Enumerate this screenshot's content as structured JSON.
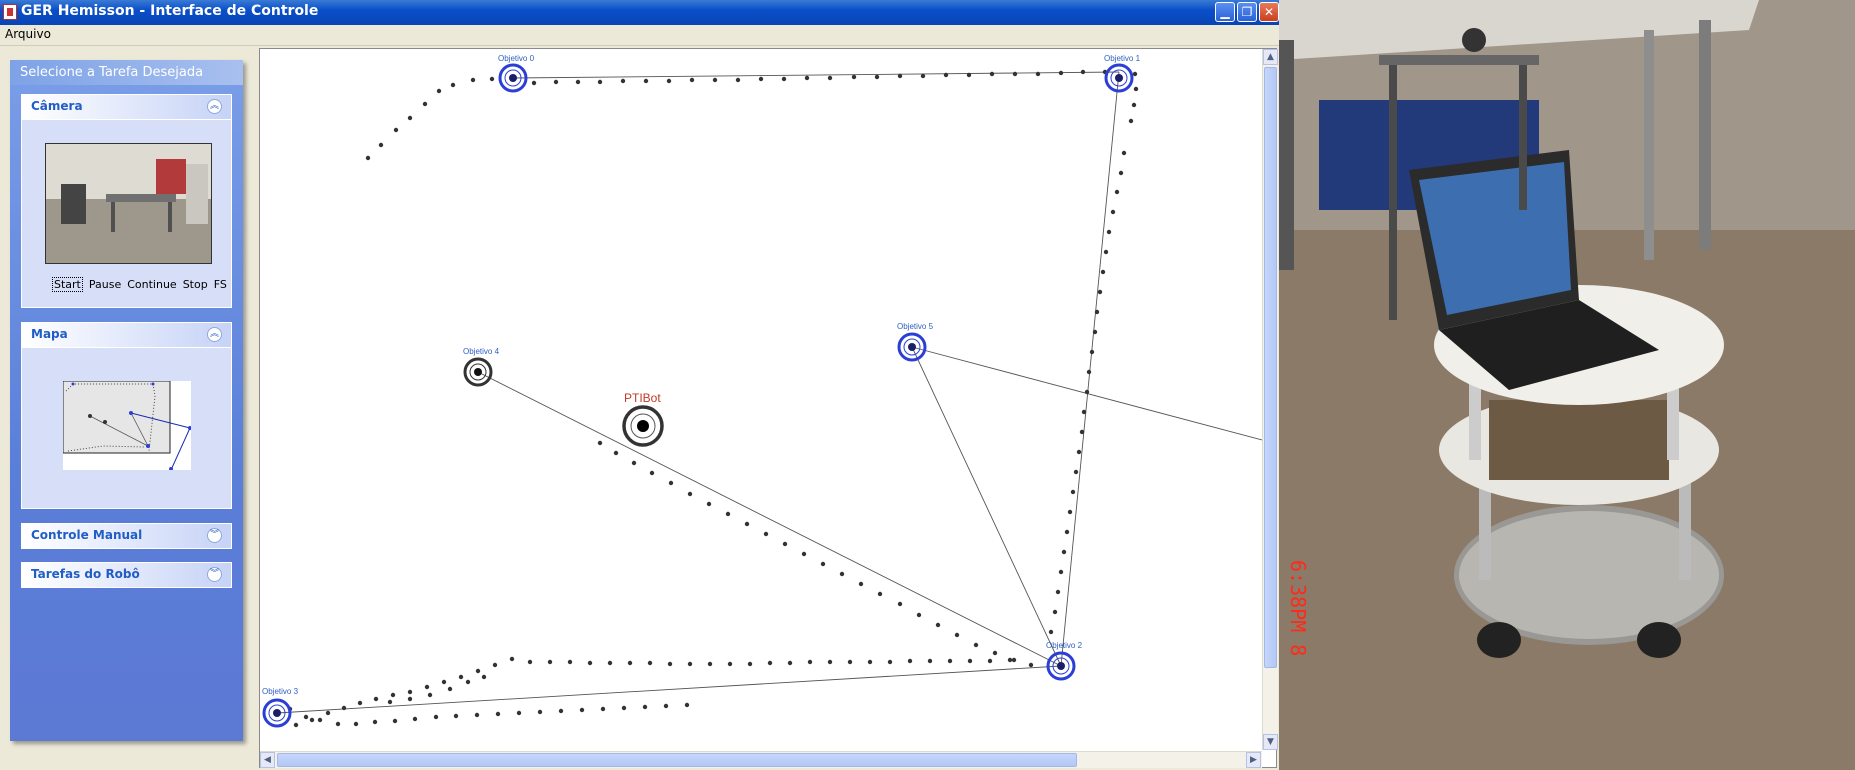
{
  "window": {
    "title": "GER Hemisson - Interface de Controle",
    "controls": {
      "minimize": "minimize-icon",
      "restore": "restore-icon",
      "close": "close-icon"
    }
  },
  "menubar": {
    "items": [
      "Arquivo"
    ]
  },
  "panel": {
    "header": "Selecione a Tarefa Desejada",
    "sections": {
      "camera": {
        "title": "Câmera",
        "controls": [
          "Start",
          "Pause",
          "Continue",
          "Stop",
          "FS"
        ]
      },
      "mapa": {
        "title": "Mapa"
      },
      "controle": {
        "title": "Controle Manual"
      },
      "tarefas": {
        "title": "Tarefas do Robô"
      }
    }
  },
  "map": {
    "robot_label": "PTIBot",
    "objectives": [
      {
        "label": "Objetivo 0"
      },
      {
        "label": "Objetivo 1"
      },
      {
        "label": "Objetivo 2"
      },
      {
        "label": "Objetivo 3"
      },
      {
        "label": "Objetivo 4"
      },
      {
        "label": "Objetivo 5"
      }
    ]
  },
  "photo": {
    "timestamp": "6:38PM  8"
  },
  "colors": {
    "titlebar": "#0a4fc9",
    "panel": "#5a7fd9",
    "objective_ring": "#2b3fd6",
    "robot_label": "#c0392b",
    "label_text": "#2f5ec4"
  }
}
